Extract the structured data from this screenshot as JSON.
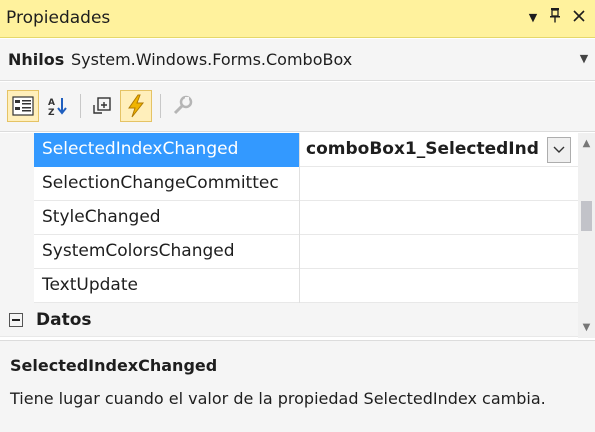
{
  "window": {
    "title": "Propiedades",
    "dropdown_glyph": "▼",
    "pin_glyph": "📌",
    "close_glyph": "✕"
  },
  "object_selector": {
    "name": "Nhilos",
    "type": "System.Windows.Forms.ComboBox",
    "drop_glyph": "▼"
  },
  "toolbar": {
    "buttons": [
      "categorized-icon",
      "alphabetical-icon",
      "properties-icon",
      "events-icon",
      "property-pages-icon"
    ],
    "active": "events-icon"
  },
  "grid": {
    "rows": [
      {
        "name": "SelectedIndexChanged",
        "value": "comboBox1_SelectedInd",
        "selected": true
      },
      {
        "name": "SelectionChangeCommittec",
        "value": ""
      },
      {
        "name": "StyleChanged",
        "value": ""
      },
      {
        "name": "SystemColorsChanged",
        "value": ""
      },
      {
        "name": "TextUpdate",
        "value": ""
      }
    ],
    "category": {
      "name": "Datos",
      "expanded": true
    }
  },
  "description": {
    "title": "SelectedIndexChanged",
    "text": "Tiene lugar cuando el valor de la propiedad SelectedIndex cambia."
  },
  "colors": {
    "title_bar": "#fff29d",
    "selection": "#3399ff",
    "active_tool": "#ffefbb",
    "event_bolt": "#f0b400"
  }
}
